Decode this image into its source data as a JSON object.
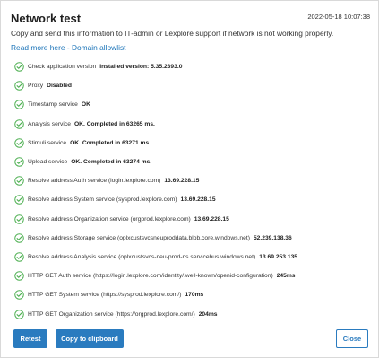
{
  "dialog": {
    "title": "Network test",
    "timestamp": "2022-05-18 10:07:38",
    "description": "Copy and send this information to IT-admin or Lexplore support if network is not working properly.",
    "link_label": "Read more here - Domain allowlist"
  },
  "icons": {
    "check": "check-circle-icon"
  },
  "colors": {
    "accent": "#2a7bbf",
    "success": "#4caf50",
    "link": "#1a73b8"
  },
  "checks": [
    {
      "label": "Check application version",
      "value": "Installed version: 5.35.2393.0"
    },
    {
      "label": "Proxy",
      "value": "Disabled"
    },
    {
      "label": "Timestamp service",
      "value": "OK"
    },
    {
      "label": "Analysis service",
      "value": "OK. Completed in 63265 ms."
    },
    {
      "label": "Stimuli service",
      "value": "OK. Completed in 63271 ms."
    },
    {
      "label": "Upload service",
      "value": "OK. Completed in 63274 ms."
    },
    {
      "label": "Resolve address Auth service (login.lexplore.com)",
      "value": "13.69.228.15"
    },
    {
      "label": "Resolve address System service (sysprod.lexplore.com)",
      "value": "13.69.228.15"
    },
    {
      "label": "Resolve address Organization service (orgprod.lexplore.com)",
      "value": "13.69.228.15"
    },
    {
      "label": "Resolve address Storage service (oplxcustsvcsneuproddata.blob.core.windows.net)",
      "value": "52.239.138.36"
    },
    {
      "label": "Resolve address Analysis service (oplxcustsvcs-neu-prod-ns.servicebus.windows.net)",
      "value": "13.69.253.135"
    },
    {
      "label": "HTTP GET Auth service (https://login.lexplore.com/identity/.well-known/openid-configuration)",
      "value": "245ms"
    },
    {
      "label": "HTTP GET System service (https://sysprod.lexplore.com/)",
      "value": "170ms"
    },
    {
      "label": "HTTP GET Organization service (https://orgprod.lexplore.com/)",
      "value": "204ms"
    }
  ],
  "buttons": {
    "retest": "Retest",
    "copy": "Copy to clipboard",
    "close": "Close"
  }
}
